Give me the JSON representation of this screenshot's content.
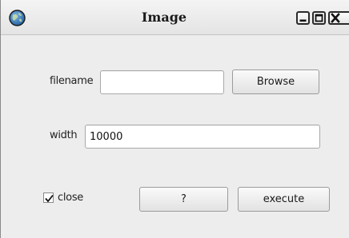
{
  "window": {
    "title": "Image"
  },
  "titlebar_buttons": {
    "minimize_icon": "minimize-icon",
    "maximize_icon": "maximize-icon",
    "close_icon": "close-icon"
  },
  "form": {
    "filename": {
      "label": "filename",
      "value": "",
      "browse_label": "Browse"
    },
    "width": {
      "label": "width",
      "value": "10000"
    },
    "close_checkbox": {
      "label": "close",
      "checked": true
    },
    "help_label": "?",
    "execute_label": "execute"
  }
}
